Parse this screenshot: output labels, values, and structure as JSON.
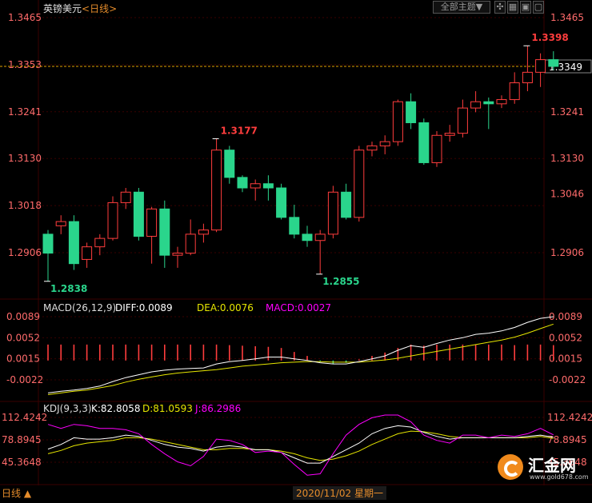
{
  "header": {
    "symbol": "英镑美元",
    "period": "<日线>",
    "main_select": "全部主题▼",
    "icons": [
      "crosshair-icon",
      "grid-icon",
      "window-icon",
      "minimize-icon"
    ]
  },
  "bottom": {
    "period_label": "日线 ▲",
    "date_label": "2020/11/02 星期一"
  },
  "logo": {
    "name": "汇金网",
    "url": "www.gold678.com"
  },
  "colors": {
    "up": "#ff3d3d",
    "down": "#2ad58c",
    "bg": "#000000",
    "grid": "#3a0000",
    "diff": "#ffffff",
    "dea": "#e6e600",
    "macd": "#ff00ff",
    "k": "#ffffff",
    "d": "#e6e600",
    "j": "#ff00ff"
  },
  "chart_data": [
    {
      "type": "candlestick",
      "title": "英镑美元<日线>",
      "y_ticks": [
        1.3465,
        1.3353,
        1.3241,
        1.313,
        1.3018,
        1.2906
      ],
      "right_labels": [
        "1.3465",
        "1.3353",
        "1.3241",
        "1.3130",
        "1.3046",
        "1.2906"
      ],
      "last_price": 1.3349,
      "annotations": [
        {
          "label": "1.3398",
          "type": "high"
        },
        {
          "label": "1.3177",
          "type": "high"
        },
        {
          "label": "1.2838",
          "type": "low"
        },
        {
          "label": "1.2855",
          "type": "low"
        }
      ],
      "candles": [
        [
          1.295,
          1.2905,
          1.296,
          1.2838
        ],
        [
          1.297,
          1.298,
          1.2995,
          1.295
        ],
        [
          1.298,
          1.288,
          1.2995,
          1.2865
        ],
        [
          1.289,
          1.292,
          1.293,
          1.287
        ],
        [
          1.292,
          1.294,
          1.295,
          1.29
        ],
        [
          1.294,
          1.3025,
          1.304,
          1.2935
        ],
        [
          1.3025,
          1.305,
          1.306,
          1.301
        ],
        [
          1.305,
          1.2945,
          1.306,
          1.2935
        ],
        [
          1.2945,
          1.301,
          1.3015,
          1.288
        ],
        [
          1.301,
          1.29,
          1.303,
          1.287
        ],
        [
          1.29,
          1.2905,
          1.292,
          1.287
        ],
        [
          1.2905,
          1.295,
          1.2985,
          1.29
        ],
        [
          1.295,
          1.296,
          1.2975,
          1.293
        ],
        [
          1.296,
          1.315,
          1.3177,
          1.2955
        ],
        [
          1.315,
          1.3085,
          1.316,
          1.307
        ],
        [
          1.3085,
          1.306,
          1.309,
          1.305
        ],
        [
          1.306,
          1.307,
          1.308,
          1.303
        ],
        [
          1.307,
          1.306,
          1.309,
          1.303
        ],
        [
          1.306,
          1.299,
          1.307,
          1.2985
        ],
        [
          1.299,
          1.295,
          1.302,
          1.294
        ],
        [
          1.295,
          1.2935,
          1.297,
          1.292
        ],
        [
          1.2935,
          1.295,
          1.296,
          1.2855
        ],
        [
          1.295,
          1.305,
          1.3065,
          1.294
        ],
        [
          1.305,
          1.299,
          1.307,
          1.2985
        ],
        [
          1.299,
          1.315,
          1.316,
          1.298
        ],
        [
          1.315,
          1.316,
          1.317,
          1.3135
        ],
        [
          1.316,
          1.317,
          1.3185,
          1.314
        ],
        [
          1.317,
          1.3265,
          1.327,
          1.316
        ],
        [
          1.3265,
          1.3215,
          1.3285,
          1.32
        ],
        [
          1.3215,
          1.312,
          1.3225,
          1.3115
        ],
        [
          1.312,
          1.3185,
          1.3195,
          1.311
        ],
        [
          1.3185,
          1.319,
          1.321,
          1.317
        ],
        [
          1.319,
          1.325,
          1.327,
          1.318
        ],
        [
          1.325,
          1.3265,
          1.329,
          1.324
        ],
        [
          1.3265,
          1.326,
          1.3275,
          1.32
        ],
        [
          1.326,
          1.327,
          1.328,
          1.325
        ],
        [
          1.327,
          1.331,
          1.3335,
          1.326
        ],
        [
          1.331,
          1.3335,
          1.3398,
          1.329
        ],
        [
          1.3335,
          1.3365,
          1.338,
          1.33
        ],
        [
          1.3365,
          1.3349,
          1.3385,
          1.334
        ]
      ]
    },
    {
      "type": "bar+line",
      "title": "MACD(26,12,9)",
      "legend": [
        "DIFF:0.0089",
        "DEA:0.0076",
        "MACD:0.0027"
      ],
      "y_ticks": [
        0.0089,
        0.0052,
        0.0015,
        -0.0022
      ],
      "y_labels": [
        "0.0089",
        "0.0052",
        "0.0015",
        "-0.0022"
      ],
      "diff": [
        -0.0045,
        -0.0042,
        -0.004,
        -0.0037,
        -0.0033,
        -0.0025,
        -0.0018,
        -0.0013,
        -0.0008,
        -0.0005,
        -0.0003,
        -0.0002,
        -0.0001,
        0.0006,
        0.001,
        0.0012,
        0.0015,
        0.0018,
        0.0018,
        0.0015,
        0.0012,
        0.0008,
        0.0006,
        0.0006,
        0.001,
        0.0015,
        0.002,
        0.003,
        0.0038,
        0.0035,
        0.0042,
        0.0048,
        0.0052,
        0.0058,
        0.006,
        0.0064,
        0.007,
        0.0079,
        0.0086,
        0.0089
      ],
      "dea": [
        -0.0048,
        -0.0045,
        -0.0042,
        -0.004,
        -0.0036,
        -0.0032,
        -0.0026,
        -0.0021,
        -0.0017,
        -0.0013,
        -0.001,
        -0.0008,
        -0.0006,
        -0.0004,
        -0.0001,
        0.0002,
        0.0004,
        0.0006,
        0.0008,
        0.0009,
        0.001,
        0.001,
        0.0009,
        0.0009,
        0.0009,
        0.0011,
        0.0013,
        0.0016,
        0.002,
        0.0024,
        0.0028,
        0.0032,
        0.0036,
        0.004,
        0.0044,
        0.0048,
        0.0053,
        0.006,
        0.0068,
        0.0076
      ],
      "macd": [
        0.0028,
        0.0028,
        0.0028,
        0.0028,
        0.0028,
        0.0028,
        0.0028,
        0.0028,
        0.0028,
        0.0028,
        0.0028,
        0.0028,
        0.0028,
        0.0028,
        0.0027,
        0.0026,
        0.0025,
        0.0024,
        0.0022,
        0.0015,
        0.0008,
        -0.0002,
        -0.0006,
        -0.0004,
        0.0002,
        0.0008,
        0.0014,
        0.0022,
        0.0028,
        0.0026,
        0.0028,
        0.0028,
        0.0028,
        0.0028,
        0.0028,
        0.0028,
        0.0027,
        0.0028,
        0.0028,
        0.0027
      ]
    },
    {
      "type": "line",
      "title": "KDJ(9,3,3)",
      "legend": [
        "K:82.8058",
        "D:81.0593",
        "J:86.2986"
      ],
      "y_ticks": [
        112.4242,
        78.8945,
        45.3648
      ],
      "y_labels": [
        "112.4242",
        "78.8945",
        "45.3648"
      ],
      "k": [
        65,
        72,
        82,
        80,
        80,
        82,
        86,
        84,
        78,
        72,
        68,
        66,
        62,
        68,
        70,
        68,
        64,
        64,
        60,
        52,
        44,
        44,
        54,
        64,
        74,
        88,
        96,
        100,
        98,
        90,
        84,
        80,
        82,
        82,
        82,
        82,
        82,
        84,
        86,
        82.8058
      ],
      "d": [
        58,
        63,
        70,
        74,
        76,
        78,
        82,
        82,
        80,
        76,
        72,
        68,
        64,
        64,
        66,
        66,
        64,
        64,
        62,
        58,
        52,
        48,
        50,
        55,
        62,
        72,
        80,
        88,
        92,
        91,
        88,
        84,
        82,
        82,
        82,
        82,
        82,
        82,
        84,
        81.0593
      ],
      "j": [
        102,
        96,
        102,
        100,
        96,
        96,
        94,
        88,
        72,
        58,
        46,
        40,
        54,
        80,
        78,
        72,
        60,
        62,
        60,
        42,
        26,
        28,
        58,
        86,
        102,
        112,
        116,
        116,
        106,
        86,
        78,
        74,
        86,
        86,
        82,
        86,
        84,
        88,
        96,
        86.2986
      ]
    }
  ]
}
